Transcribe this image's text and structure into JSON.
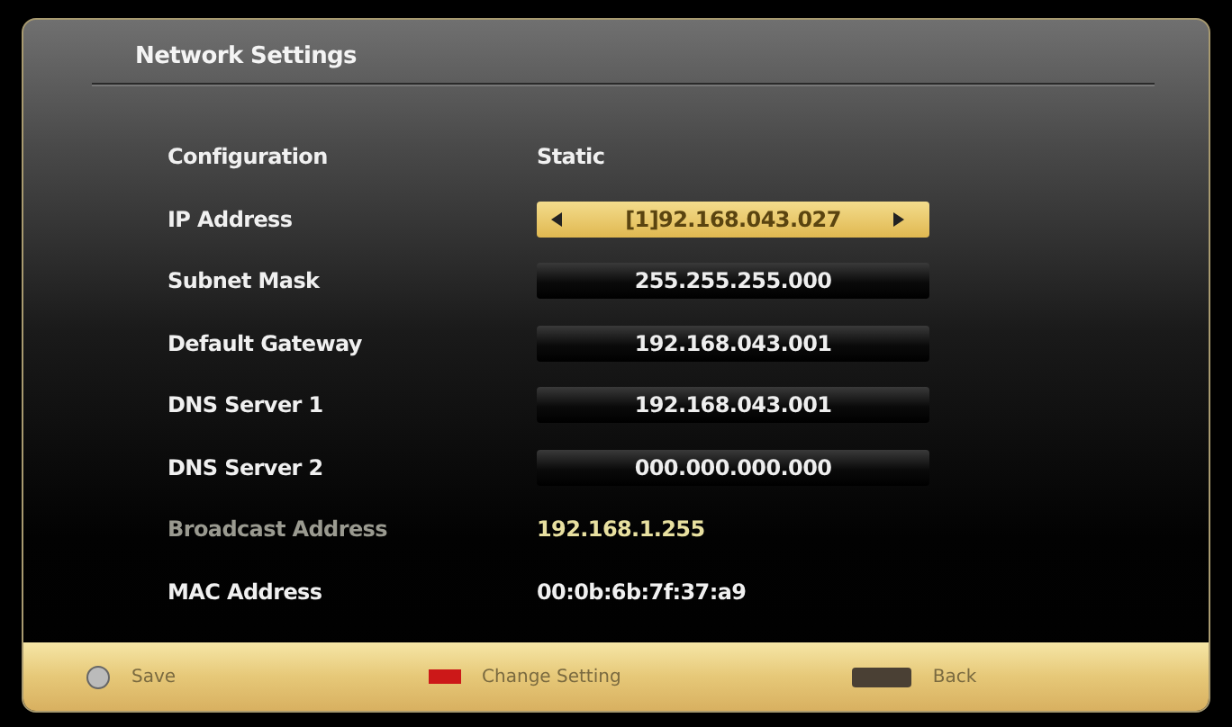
{
  "window": {
    "title": "Network Settings"
  },
  "rows": [
    {
      "label": "Configuration",
      "value": "Static",
      "kind": "plain",
      "disabled": false
    },
    {
      "label": "IP Address",
      "value": "[1]92.168.043.027",
      "kind": "field",
      "selected": true
    },
    {
      "label": "Subnet Mask",
      "value": "255.255.255.000",
      "kind": "field",
      "selected": false
    },
    {
      "label": "Default Gateway",
      "value": "192.168.043.001",
      "kind": "field",
      "selected": false
    },
    {
      "label": "DNS Server 1",
      "value": "192.168.043.001",
      "kind": "field",
      "selected": false
    },
    {
      "label": "DNS Server 2",
      "value": "000.000.000.000",
      "kind": "field",
      "selected": false
    },
    {
      "label": "Broadcast Address",
      "value": "192.168.1.255",
      "kind": "plain",
      "disabled": true
    },
    {
      "label": "MAC Address",
      "value": "00:0b:6b:7f:37:a9",
      "kind": "plain",
      "disabled": false
    }
  ],
  "footer": [
    {
      "label": "Save",
      "kind": "ok"
    },
    {
      "label": "Change Setting",
      "kind": "red"
    },
    {
      "label": "Back",
      "kind": "return"
    }
  ]
}
